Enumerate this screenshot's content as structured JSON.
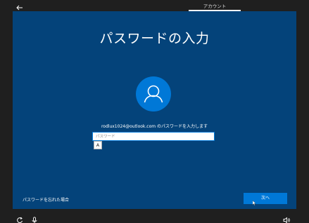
{
  "header": {
    "tab_label": "アカウント"
  },
  "main": {
    "title": "パスワードの入力",
    "instruction": "rodlux1024@outlook.com のパスワードを入力します",
    "password_placeholder": "パスワード",
    "ime_mode": "A",
    "forgot_password": "パスワードを忘れた場合",
    "next_button": "次へ"
  },
  "colors": {
    "panel_bg": "#04437a",
    "accent": "#0078d7",
    "frame_bg": "#1f1f1f"
  },
  "icons": {
    "back": "back-arrow-icon",
    "avatar": "user-icon",
    "accessibility": "ease-of-access-icon",
    "microphone": "microphone-icon",
    "volume": "volume-icon"
  }
}
